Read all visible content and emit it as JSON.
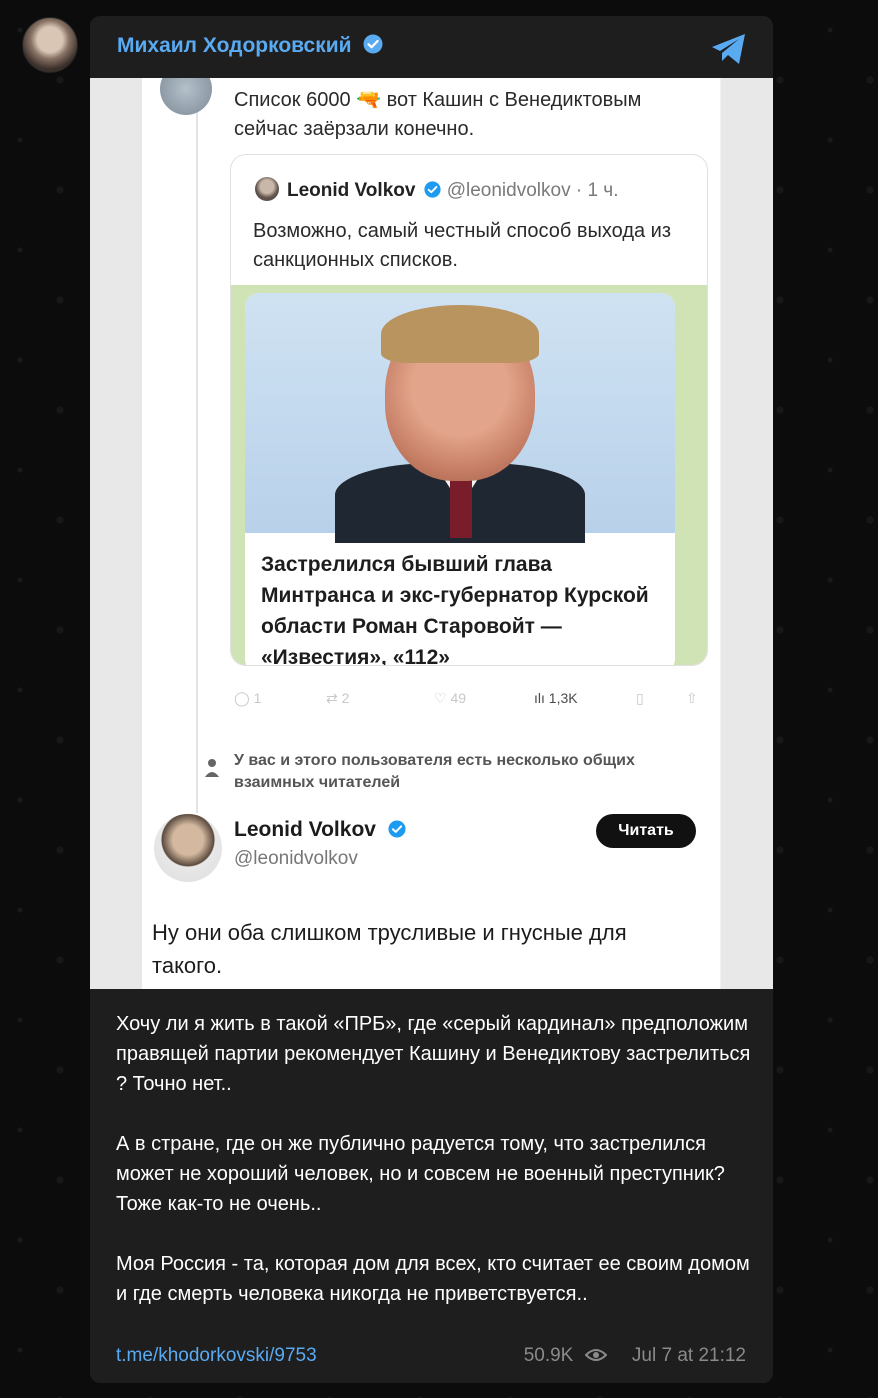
{
  "channel": {
    "author": "Михаил Ходорковский",
    "verified": true,
    "accent_color": "#5aaaf2"
  },
  "post": {
    "tweet_top_text": "Список 6000 🔫 вот Кашин с Венедиктовым сейчас заёрзали конечно.",
    "quote": {
      "name": "Leonid Volkov",
      "handle": "@leonidvolkov · 1 ч.",
      "text": "Возможно, самый честный способ выхода из санкционных списков.",
      "news_headline": "Застрелился бывший глава Минтранса и экс-губернатор Курской области Роман Старовойт — «Известия», «112»"
    },
    "tweet_actions": {
      "replies": "1",
      "retweets": "2",
      "likes": "49",
      "views": "1,3K"
    },
    "mutual_note": "У вас и этого пользователя есть несколько общих взаимных читателей",
    "profile": {
      "name": "Leonid Volkov",
      "handle": "@leonidvolkov",
      "follow_label": "Читать"
    },
    "reply_text": "Ну они оба слишком трусливые и гнусные для такого.",
    "caption_paragraphs": [
      "Хочу ли я жить в такой «ПРБ», где «серый кардинал» предположим правящей партии рекомендует Кашину и Венедиктову застрелиться ? Точно нет..",
      "А в стране, где он же публично радуется тому, что застрелился может не хороший человек, но и совсем не военный преступник? Тоже как-то не очень..",
      "Моя Россия - та, которая дом для всех, кто считает ее своим домом и где смерть человека никогда не приветствуется.."
    ],
    "link": "t.me/khodorkovski/9753",
    "views": "50.9K",
    "date": "Jul 7 at 21:12"
  }
}
